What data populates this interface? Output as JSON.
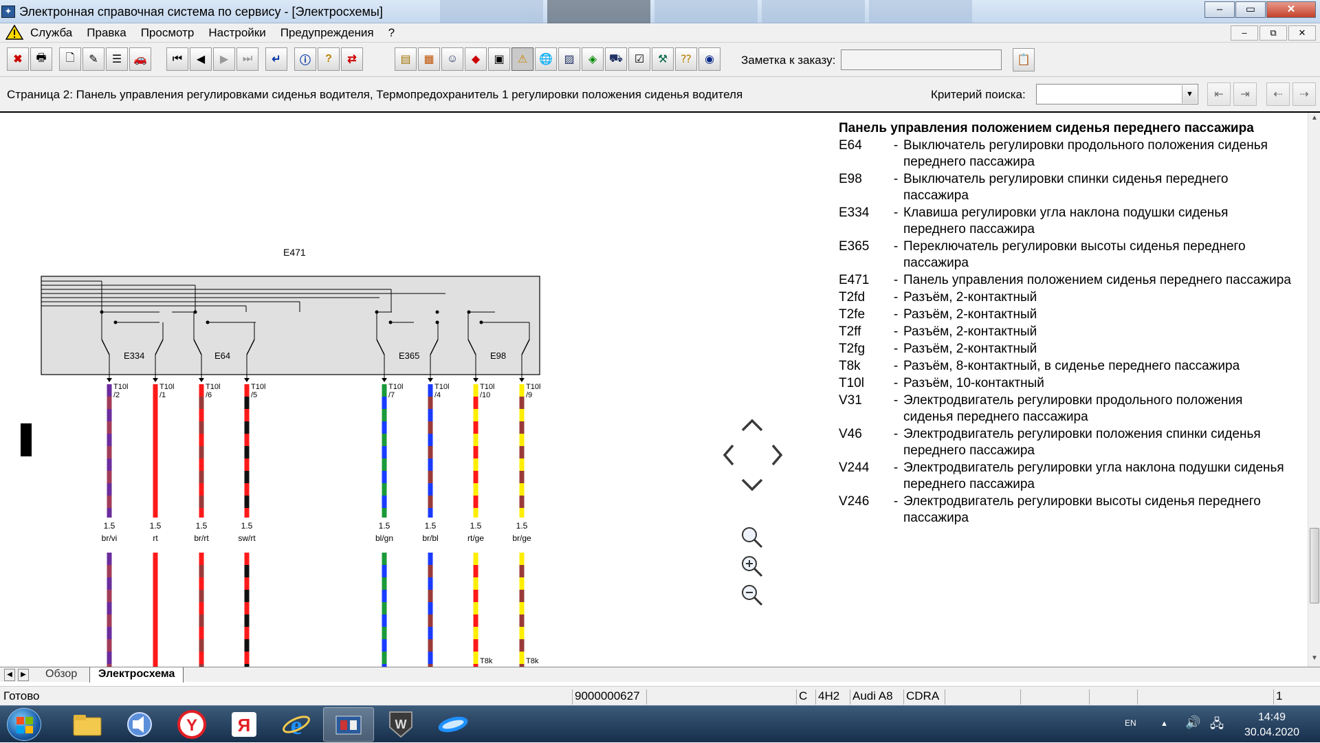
{
  "window": {
    "title": "Электронная справочная система по сервису - [Электросхемы]",
    "app_icon_text": "ELSA"
  },
  "menu": {
    "items": [
      "Служба",
      "Правка",
      "Просмотр",
      "Настройки",
      "Предупреждения",
      "?"
    ]
  },
  "toolbar": {
    "note_label": "Заметка к заказу:",
    "note_value": ""
  },
  "page": {
    "title": "Страница 2: Панель управления регулировками сиденья водителя, Термопредохранитель 1 регулировки положения сиденья водителя",
    "search_label": "Критерий поиска:",
    "search_value": ""
  },
  "diagram": {
    "panel_label": "E471",
    "switches": [
      "E334",
      "E64",
      "E365",
      "E98"
    ],
    "wires": [
      {
        "pin": "T10l /2",
        "gauge": "1.5",
        "color_code": "br/vi",
        "c1": "#a23c5a",
        "c2": "#6b2d9e"
      },
      {
        "pin": "T10l /1",
        "gauge": "1.5",
        "color_code": "rt",
        "c1": "#ff1a1a",
        "c2": "#ff1a1a"
      },
      {
        "pin": "T10l /6",
        "gauge": "1.5",
        "color_code": "br/rt",
        "c1": "#9a3a3a",
        "c2": "#ff1a1a"
      },
      {
        "pin": "T10l /5",
        "gauge": "1.5",
        "color_code": "sw/rt",
        "c1": "#111111",
        "c2": "#ff1a1a"
      },
      {
        "pin": "T10l /7",
        "gauge": "1.5",
        "color_code": "bl/gn",
        "c1": "#1a3bff",
        "c2": "#1a9a3a"
      },
      {
        "pin": "T10l /4",
        "gauge": "1.5",
        "color_code": "br/bl",
        "c1": "#9a3a3a",
        "c2": "#1a3bff"
      },
      {
        "pin": "T10l /10",
        "gauge": "1.5",
        "color_code": "rt/ge",
        "c1": "#ff1a1a",
        "c2": "#ffee00"
      },
      {
        "pin": "T10l /9",
        "gauge": "1.5",
        "color_code": "br/ge",
        "c1": "#9a3a3a",
        "c2": "#ffee00"
      }
    ],
    "bottom_connector": "T8k"
  },
  "legend": {
    "title": "Панель управления положением сиденья переднего пассажира",
    "items": [
      {
        "code": "E64",
        "desc": "Выключатель регулировки продольного положения сиденья переднего пассажира"
      },
      {
        "code": "E98",
        "desc": "Выключатель регулировки спинки сиденья переднего пассажира"
      },
      {
        "code": "E334",
        "desc": "Клавиша регулировки угла наклона подушки сиденья переднего пассажира"
      },
      {
        "code": "E365",
        "desc": "Переключатель регулировки высоты сиденья переднего пассажира"
      },
      {
        "code": "E471",
        "desc": "Панель управления положением сиденья переднего пассажира"
      },
      {
        "code": "T2fd",
        "desc": "Разъём, 2-контактный"
      },
      {
        "code": "T2fe",
        "desc": "Разъём, 2-контактный"
      },
      {
        "code": "T2ff",
        "desc": "Разъём, 2-контактный"
      },
      {
        "code": "T2fg",
        "desc": "Разъём, 2-контактный"
      },
      {
        "code": "T8k",
        "desc": "Разъём, 8-контактный, в сиденье переднего пассажира"
      },
      {
        "code": "T10l",
        "desc": "Разъём, 10-контактный"
      },
      {
        "code": "V31",
        "desc": "Электродвигатель регулировки продольного положения сиденья переднего пассажира"
      },
      {
        "code": "V46",
        "desc": "Электродвигатель регулировки положения спинки сиденья переднего пассажира"
      },
      {
        "code": "V244",
        "desc": "Электродвигатель регулировки угла наклона подушки сиденья переднего пассажира"
      },
      {
        "code": "V246",
        "desc": "Электродвигатель регулировки высоты сиденья переднего пассажира"
      }
    ]
  },
  "tabs": {
    "overview": "Обзор",
    "active": "Электросхема"
  },
  "status": {
    "ready": "Готово",
    "order": "9000000627",
    "c": "C",
    "code": "4H2",
    "model": "Audi A8",
    "engine": "CDRA",
    "page_num": "1"
  },
  "taskbar": {
    "lang": "EN",
    "time": "14:49",
    "date": "30.04.2020"
  },
  "colors": {
    "accent": "#1a3bff",
    "title_gradient": "#c5d8ee"
  }
}
